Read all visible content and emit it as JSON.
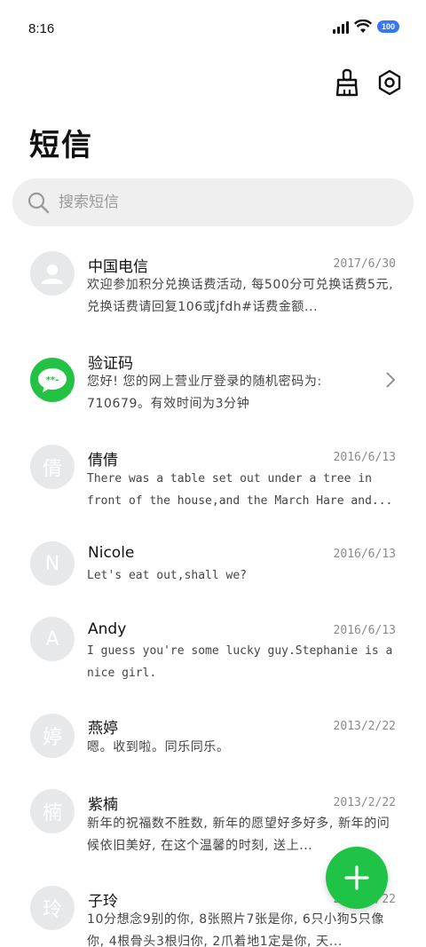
{
  "status": {
    "time": "8:16",
    "battery": "100"
  },
  "header": {
    "title": "短信"
  },
  "search": {
    "placeholder": "搜索短信"
  },
  "colors": {
    "accent_green": "#1fc447",
    "avatar_gray": "#e7e8ea",
    "battery_blue": "#3478f6"
  },
  "icons": {
    "clean": "broom-icon",
    "settings": "settings-hex-icon",
    "search": "search-icon",
    "fab": "plus-icon"
  },
  "conversations": [
    {
      "name": "中国电信",
      "date": "2017/6/30",
      "preview": "欢迎参加积分兑换话费活动, 每500分可兑换话费5元, 兑换话费请回复106或jfdh#话费金额...",
      "avatar": "person-icon"
    },
    {
      "name": "验证码",
      "date": "",
      "preview": "您好! 您的网上营业厅登录的随机密码为: 710679。有效时间为3分钟",
      "avatar": "message-icon"
    },
    {
      "name": "倩倩",
      "date": "2016/6/13",
      "preview": "There was a table set out under a tree in front of the house,and the March Hare and...",
      "avatar": "倩"
    },
    {
      "name": "Nicole",
      "date": "2016/6/13",
      "preview": "Let's eat out,shall we?",
      "avatar": "N"
    },
    {
      "name": "Andy",
      "date": "2016/6/13",
      "preview": "I guess you're some lucky guy.Stephanie is a nice girl.",
      "avatar": "A"
    },
    {
      "name": "燕婷",
      "date": "2013/2/22",
      "preview": "嗯。收到啦。同乐同乐。",
      "avatar": "婷"
    },
    {
      "name": "紫楠",
      "date": "2013/2/22",
      "preview": "新年的祝福数不胜数, 新年的愿望好多好多, 新年的问候依旧美好, 在这个温馨的时刻, 送上...",
      "avatar": "楠"
    },
    {
      "name": "子玲",
      "date": "2013/2/22",
      "preview": "10分想念9别的你, 8张照片7张是你, 6只小狗5只像你, 4根骨头3根归你, 2爪着地1定是你, 天...",
      "avatar": "玲"
    }
  ]
}
